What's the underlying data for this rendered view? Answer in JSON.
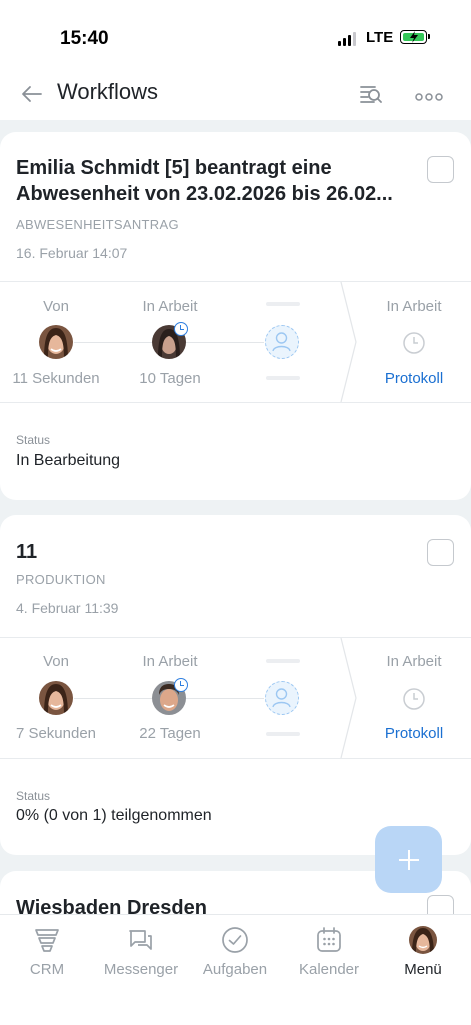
{
  "status_bar": {
    "time": "15:40",
    "network": "LTE"
  },
  "header": {
    "title": "Workflows"
  },
  "cards": [
    {
      "title_line1": "Emilia Schmidt [5] beantragt eine",
      "title_line2": "Abwesenheit von 23.02.2026 bis 26.02...",
      "type": "ABWESENHEITSANTRAG",
      "date": "16. Februar 14:07",
      "flow": {
        "from_label": "Von",
        "from_time": "11 Sekunden",
        "in_work_label": "In Arbeit",
        "in_work_time": "10 Tagen",
        "right_label": "In Arbeit",
        "protocol": "Protokoll"
      },
      "status_label": "Status",
      "status_value": "In Bearbeitung"
    },
    {
      "title_line1": "11",
      "type": "PRODUKTION",
      "date": "4. Februar 11:39",
      "flow": {
        "from_label": "Von",
        "from_time": "7 Sekunden",
        "in_work_label": "In Arbeit",
        "in_work_time": "22 Tagen",
        "right_label": "In Arbeit",
        "protocol": "Protokoll"
      },
      "status_label": "Status",
      "status_value": "0% (0 von 1) teilgenommen"
    },
    {
      "title_line1": "Wiesbaden Dresden"
    }
  ],
  "tabbar": [
    {
      "label": "CRM",
      "icon": "crm-icon"
    },
    {
      "label": "Messenger",
      "icon": "chat-bubbles-icon"
    },
    {
      "label": "Aufgaben",
      "icon": "check-circle-icon"
    },
    {
      "label": "Kalender",
      "icon": "calendar-icon"
    },
    {
      "label": "Menü",
      "icon": "avatar",
      "active": true
    }
  ],
  "colors": {
    "accent": "#1a6fd1",
    "fab": "#b9d6f6",
    "background": "#eef2f4"
  }
}
